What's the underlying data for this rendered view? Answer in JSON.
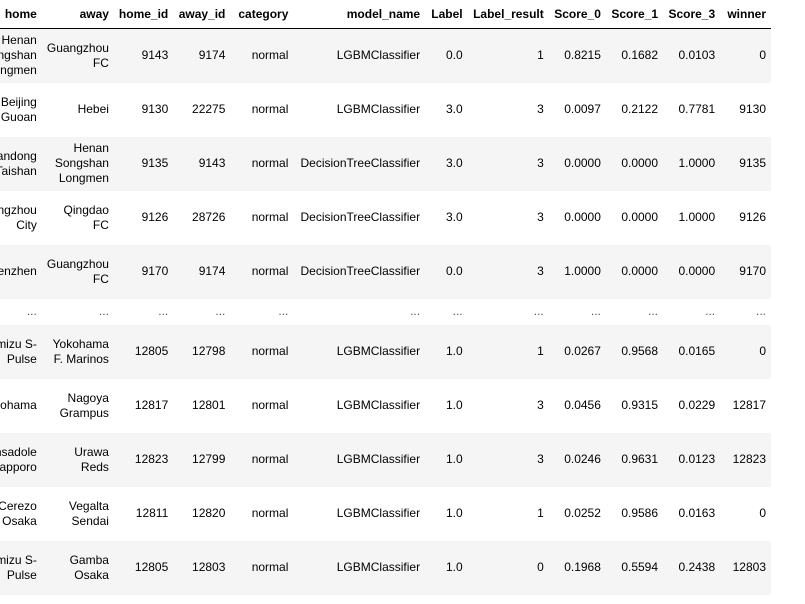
{
  "columns": [
    "home",
    "away",
    "home_id",
    "away_id",
    "category",
    "model_name",
    "Label",
    "Label_result",
    "Score_0",
    "Score_1",
    "Score_3",
    "winner"
  ],
  "rows": [
    {
      "home": "Henan Songshan Longmen",
      "away": "Guangzhou FC",
      "home_id": "9143",
      "away_id": "9174",
      "category": "normal",
      "model_name": "LGBMClassifier",
      "Label": "0.0",
      "Label_result": "1",
      "Score_0": "0.8215",
      "Score_1": "0.1682",
      "Score_3": "0.0103",
      "winner": "0"
    },
    {
      "home": "Beijing Guoan",
      "away": "Hebei",
      "home_id": "9130",
      "away_id": "22275",
      "category": "normal",
      "model_name": "LGBMClassifier",
      "Label": "3.0",
      "Label_result": "3",
      "Score_0": "0.0097",
      "Score_1": "0.2122",
      "Score_3": "0.7781",
      "winner": "9130"
    },
    {
      "home": "Shandong Taishan",
      "away": "Henan Songshan Longmen",
      "home_id": "9135",
      "away_id": "9143",
      "category": "normal",
      "model_name": "DecisionTreeClassifier",
      "Label": "3.0",
      "Label_result": "3",
      "Score_0": "0.0000",
      "Score_1": "0.0000",
      "Score_3": "1.0000",
      "winner": "9135"
    },
    {
      "home": "Cangzhou City",
      "away": "Qingdao FC",
      "home_id": "9126",
      "away_id": "28726",
      "category": "normal",
      "model_name": "DecisionTreeClassifier",
      "Label": "3.0",
      "Label_result": "3",
      "Score_0": "0.0000",
      "Score_1": "0.0000",
      "Score_3": "1.0000",
      "winner": "9126"
    },
    {
      "home": "Shenzhen",
      "away": "Guangzhou FC",
      "home_id": "9170",
      "away_id": "9174",
      "category": "normal",
      "model_name": "DecisionTreeClassifier",
      "Label": "0.0",
      "Label_result": "3",
      "Score_0": "1.0000",
      "Score_1": "0.0000",
      "Score_3": "0.0000",
      "winner": "9170"
    },
    {
      "home": "...",
      "away": "...",
      "home_id": "...",
      "away_id": "...",
      "category": "...",
      "model_name": "...",
      "Label": "...",
      "Label_result": "...",
      "Score_0": "...",
      "Score_1": "...",
      "Score_3": "...",
      "winner": "..."
    },
    {
      "home": "Shimizu S-Pulse",
      "away": "Yokohama F. Marinos",
      "home_id": "12805",
      "away_id": "12798",
      "category": "normal",
      "model_name": "LGBMClassifier",
      "Label": "1.0",
      "Label_result": "1",
      "Score_0": "0.0267",
      "Score_1": "0.9568",
      "Score_3": "0.0165",
      "winner": "0"
    },
    {
      "home": "Yokohama",
      "away": "Nagoya Grampus",
      "home_id": "12817",
      "away_id": "12801",
      "category": "normal",
      "model_name": "LGBMClassifier",
      "Label": "1.0",
      "Label_result": "3",
      "Score_0": "0.0456",
      "Score_1": "0.9315",
      "Score_3": "0.0229",
      "winner": "12817"
    },
    {
      "home": "Consadole Sapporo",
      "away": "Urawa Reds",
      "home_id": "12823",
      "away_id": "12799",
      "category": "normal",
      "model_name": "LGBMClassifier",
      "Label": "1.0",
      "Label_result": "3",
      "Score_0": "0.0246",
      "Score_1": "0.9631",
      "Score_3": "0.0123",
      "winner": "12823"
    },
    {
      "home": "Cerezo Osaka",
      "away": "Vegalta Sendai",
      "home_id": "12811",
      "away_id": "12820",
      "category": "normal",
      "model_name": "LGBMClassifier",
      "Label": "1.0",
      "Label_result": "1",
      "Score_0": "0.0252",
      "Score_1": "0.9586",
      "Score_3": "0.0163",
      "winner": "0"
    },
    {
      "home": "Shimizu S-Pulse",
      "away": "Gamba Osaka",
      "home_id": "12805",
      "away_id": "12803",
      "category": "normal",
      "model_name": "LGBMClassifier",
      "Label": "1.0",
      "Label_result": "0",
      "Score_0": "0.1968",
      "Score_1": "0.5594",
      "Score_3": "0.2438",
      "winner": "12803"
    }
  ]
}
